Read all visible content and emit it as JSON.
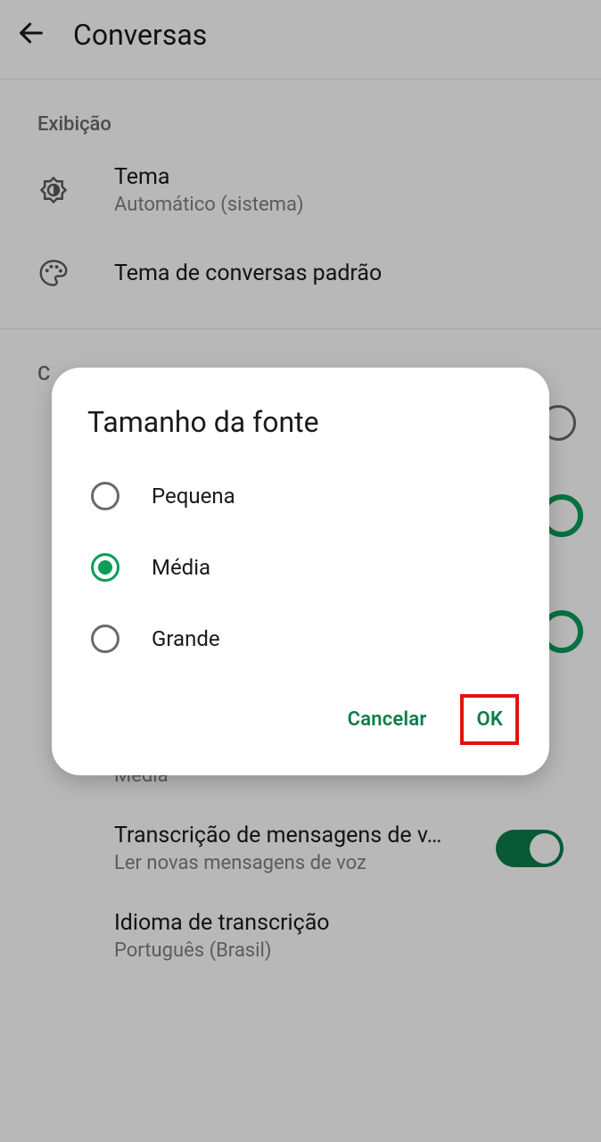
{
  "appbar": {
    "title": "Conversas"
  },
  "sections": {
    "display": {
      "header": "Exibição",
      "theme": {
        "title": "Tema",
        "sub": "Automático (sistema)"
      },
      "chatTheme": {
        "title": "Tema de conversas padrão"
      }
    },
    "chats": {
      "header": "C",
      "fontSize": {
        "title": "Tamanho da fonte",
        "sub": "Média"
      },
      "voiceTranscript": {
        "title": "Transcrição de mensagens de v…",
        "sub": "Ler novas mensagens de voz"
      },
      "transcriptLang": {
        "title": "Idioma de transcrição",
        "sub": "Português (Brasil)"
      }
    }
  },
  "dialog": {
    "title": "Tamanho da fonte",
    "options": {
      "small": "Pequena",
      "medium": "Média",
      "large": "Grande"
    },
    "selected": "medium",
    "cancel": "Cancelar",
    "ok": "OK"
  },
  "colors": {
    "accent": "#0a7d4a",
    "radioAccent": "#0a9d58",
    "highlight": "#e11313"
  }
}
